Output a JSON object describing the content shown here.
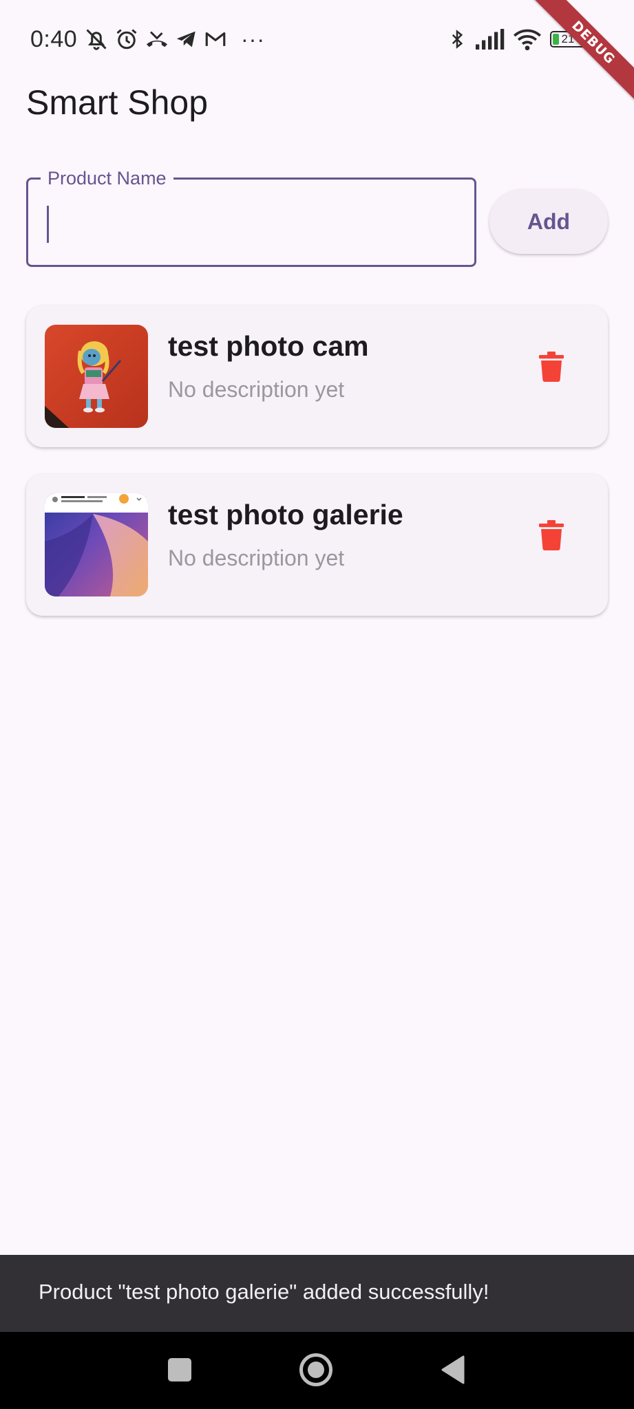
{
  "status_bar": {
    "time": "0:40",
    "battery_level": "21",
    "left_icons": [
      "mute-icon",
      "alarm-icon",
      "missed-call-icon",
      "telegram-icon",
      "gmail-icon"
    ],
    "more_indicator": "···",
    "right_icons": [
      "bluetooth-icon",
      "signal-icon",
      "wifi-icon",
      "battery-icon"
    ]
  },
  "debug_banner": "DEBUG",
  "app_bar": {
    "title": "Smart Shop"
  },
  "product_input": {
    "label": "Product Name",
    "value": ""
  },
  "add_button": {
    "label": "Add"
  },
  "products": [
    {
      "name": "test photo cam",
      "description": "No description yet",
      "thumbnail": "camera-photo"
    },
    {
      "name": "test photo galerie",
      "description": "No description yet",
      "thumbnail": "gallery-screenshot"
    }
  ],
  "snackbar": {
    "message": "Product \"test photo galerie\" added successfully!"
  },
  "colors": {
    "background": "#fcf6fd",
    "primary": "#65558f",
    "card": "#f7f1f8",
    "delete": "#f44336",
    "snackbar": "#322f35"
  }
}
